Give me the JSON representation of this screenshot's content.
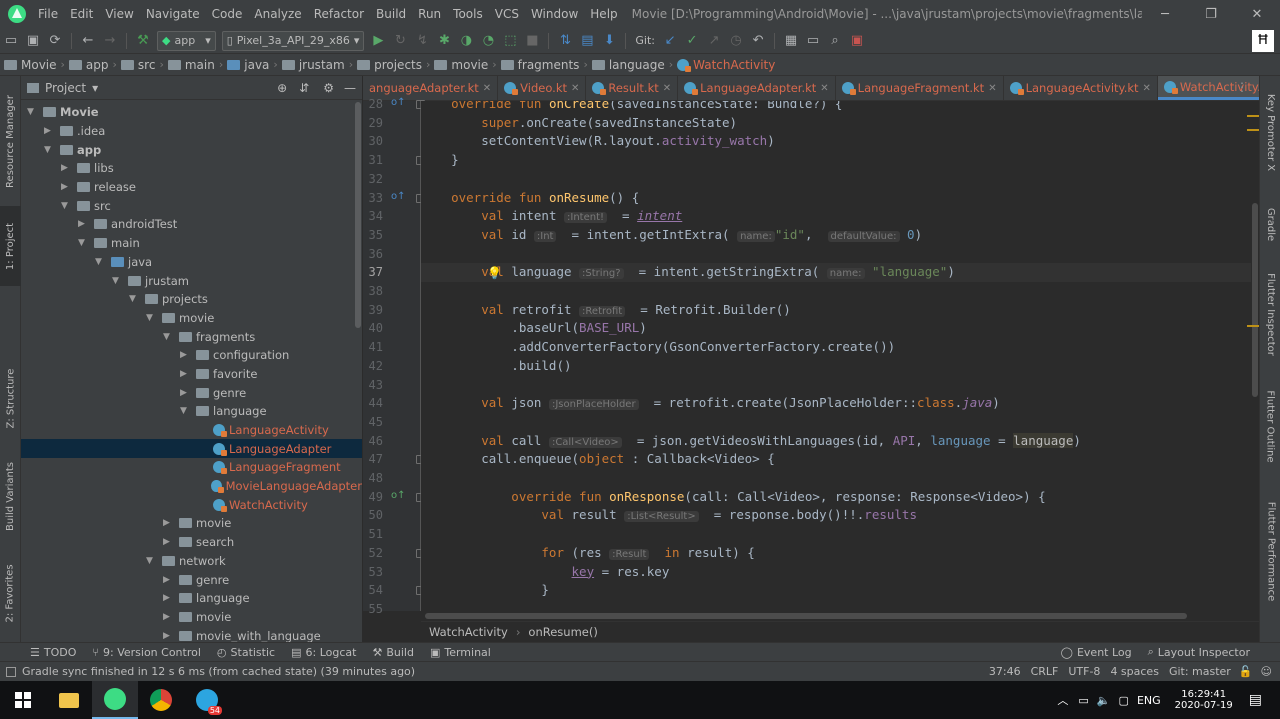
{
  "menubar": {
    "items": [
      "File",
      "Edit",
      "View",
      "Navigate",
      "Code",
      "Analyze",
      "Refactor",
      "Build",
      "Run",
      "Tools",
      "VCS",
      "Window",
      "Help"
    ],
    "title": "Movie [D:\\Programming\\Android\\Movie] - ...\\java\\jrustam\\projects\\movie\\fragments\\language\\WatchActivity.kt [app]",
    "minimize": "─",
    "maximize": "❐",
    "close": "✕"
  },
  "toolbar": {
    "module": "app",
    "device": "Pixel_3a_API_29_x86",
    "git_label": "Git:"
  },
  "navbar": {
    "crumbs": [
      "Movie",
      "app",
      "src",
      "main",
      "java",
      "jrustam",
      "projects",
      "movie",
      "fragments",
      "language",
      "WatchActivity"
    ]
  },
  "project_panel": {
    "title": "Project",
    "tree": [
      {
        "label": "Movie",
        "arrow": "▼",
        "kind": "folder",
        "bold": true
      },
      {
        "label": ".idea",
        "arrow": "▶",
        "kind": "folder"
      },
      {
        "label": "app",
        "arrow": "▼",
        "kind": "folder",
        "bold": true
      },
      {
        "label": "libs",
        "arrow": "▶",
        "kind": "folder"
      },
      {
        "label": "release",
        "arrow": "▶",
        "kind": "folder"
      },
      {
        "label": "src",
        "arrow": "▼",
        "kind": "folder"
      },
      {
        "label": "androidTest",
        "arrow": "▶",
        "kind": "folder"
      },
      {
        "label": "main",
        "arrow": "▼",
        "kind": "folder"
      },
      {
        "label": "java",
        "arrow": "▼",
        "kind": "folder-blue"
      },
      {
        "label": "jrustam",
        "arrow": "▼",
        "kind": "folder"
      },
      {
        "label": "projects",
        "arrow": "▼",
        "kind": "folder"
      },
      {
        "label": "movie",
        "arrow": "▼",
        "kind": "folder"
      },
      {
        "label": "fragments",
        "arrow": "▼",
        "kind": "folder"
      },
      {
        "label": "configuration",
        "arrow": "▶",
        "kind": "folder"
      },
      {
        "label": "favorite",
        "arrow": "▶",
        "kind": "folder"
      },
      {
        "label": "genre",
        "arrow": "▶",
        "kind": "folder"
      },
      {
        "label": "language",
        "arrow": "▼",
        "kind": "folder"
      },
      {
        "label": "LanguageActivity",
        "arrow": "",
        "kind": "kt"
      },
      {
        "label": "LanguageAdapter",
        "arrow": "",
        "kind": "kt",
        "selected": true
      },
      {
        "label": "LanguageFragment",
        "arrow": "",
        "kind": "kt"
      },
      {
        "label": "MovieLanguageAdapter",
        "arrow": "",
        "kind": "kt"
      },
      {
        "label": "WatchActivity",
        "arrow": "",
        "kind": "kt"
      },
      {
        "label": "movie",
        "arrow": "▶",
        "kind": "folder"
      },
      {
        "label": "search",
        "arrow": "▶",
        "kind": "folder"
      },
      {
        "label": "network",
        "arrow": "▼",
        "kind": "folder"
      },
      {
        "label": "genre",
        "arrow": "▶",
        "kind": "folder"
      },
      {
        "label": "language",
        "arrow": "▶",
        "kind": "folder"
      },
      {
        "label": "movie",
        "arrow": "▶",
        "kind": "folder"
      },
      {
        "label": "movie_with_language",
        "arrow": "▶",
        "kind": "folder"
      }
    ]
  },
  "left_tabs": [
    "Resource Manager",
    "1: Project",
    "Z: Structure",
    "Build Variants",
    "2: Favorites"
  ],
  "right_tabs": [
    "Key Promoter X",
    "Gradle",
    "Flutter Inspector",
    "Flutter Outline",
    "Flutter Performance"
  ],
  "editor_tabs": [
    {
      "label": "anguageAdapter.kt",
      "active": false
    },
    {
      "label": "Video.kt",
      "active": false
    },
    {
      "label": "Result.kt",
      "active": false
    },
    {
      "label": "LanguageAdapter.kt",
      "active": false
    },
    {
      "label": "LanguageFragment.kt",
      "active": false
    },
    {
      "label": "LanguageActivity.kt",
      "active": false
    },
    {
      "label": "WatchActivity.kt",
      "active": true
    }
  ],
  "code": {
    "line_numbers": [
      "28",
      "29",
      "30",
      "31",
      "32",
      "33",
      "34",
      "35",
      "36",
      "37",
      "38",
      "39",
      "40",
      "41",
      "42",
      "43",
      "44",
      "45",
      "46",
      "47",
      "48",
      "49",
      "50",
      "51",
      "52",
      "53",
      "54",
      "55"
    ],
    "current_line": "37",
    "lines": [
      [
        [
          "k",
          "    override fun "
        ],
        [
          "f",
          "onCreate"
        ],
        [
          "t",
          "(savedInstanceState: Bundle?) {"
        ]
      ],
      [
        [
          "k",
          "        super"
        ],
        [
          "t",
          ".onCreate(savedInstanceState)"
        ]
      ],
      [
        [
          "t",
          "        setContentView(R.layout."
        ],
        [
          "p",
          "activity_watch"
        ],
        [
          "t",
          ")"
        ]
      ],
      [
        [
          "t",
          "    }"
        ]
      ],
      [],
      [
        [
          "k",
          "    override fun "
        ],
        [
          "f",
          "onResume"
        ],
        [
          "t",
          "() {"
        ]
      ],
      [
        [
          "k",
          "        val "
        ],
        [
          "t",
          "intent "
        ],
        [
          "h",
          ":Intent!"
        ],
        [
          "t",
          "  = "
        ],
        [
          "pi",
          "intent"
        ]
      ],
      [
        [
          "k",
          "        val "
        ],
        [
          "t",
          "id "
        ],
        [
          "h",
          ":Int"
        ],
        [
          "t",
          "  = intent.getIntExtra( "
        ],
        [
          "h",
          "name:"
        ],
        [
          "s",
          "\"id\""
        ],
        [
          "t",
          ",  "
        ],
        [
          "h",
          "defaultValue:"
        ],
        [
          "n",
          " 0"
        ],
        [
          "t",
          ")"
        ]
      ],
      [],
      [
        [
          "k",
          "        val "
        ],
        [
          "t",
          "language "
        ],
        [
          "h",
          ":String?"
        ],
        [
          "t",
          "  = intent.getStringExtra( "
        ],
        [
          "h",
          "name:"
        ],
        [
          "s",
          " \"language\""
        ],
        [
          "t",
          ")"
        ]
      ],
      [],
      [
        [
          "k",
          "        val "
        ],
        [
          "t",
          "retrofit "
        ],
        [
          "h",
          ":Retrofit"
        ],
        [
          "t",
          "  = Retrofit.Builder()"
        ]
      ],
      [
        [
          "t",
          "            .baseUrl("
        ],
        [
          "p",
          "BASE_URL"
        ],
        [
          "t",
          ")"
        ]
      ],
      [
        [
          "t",
          "            .addConverterFactory(GsonConverterFactory.create())"
        ]
      ],
      [
        [
          "t",
          "            .build()"
        ]
      ],
      [],
      [
        [
          "k",
          "        val "
        ],
        [
          "t",
          "json "
        ],
        [
          "h",
          ":JsonPlaceHolder"
        ],
        [
          "t",
          "  = retrofit.create(JsonPlaceHolder::"
        ],
        [
          "k",
          "class"
        ],
        [
          "t",
          "."
        ],
        [
          "pi2",
          "java"
        ],
        [
          "t",
          ")"
        ]
      ],
      [],
      [
        [
          "k",
          "        val "
        ],
        [
          "t",
          "call "
        ],
        [
          "h",
          ":Call<Video>"
        ],
        [
          "t",
          "  = json.getVideosWithLanguages(id, "
        ],
        [
          "p",
          "API"
        ],
        [
          "t",
          ", "
        ],
        [
          "p2",
          "language"
        ],
        [
          "t",
          " = "
        ],
        [
          "hl",
          "language"
        ],
        [
          "t",
          ")"
        ]
      ],
      [
        [
          "t",
          "        call.enqueue("
        ],
        [
          "k",
          "object "
        ],
        [
          "t",
          ": Callback<Video> {"
        ]
      ],
      [],
      [
        [
          "k",
          "            override fun "
        ],
        [
          "f",
          "onResponse"
        ],
        [
          "t",
          "(call: Call<Video>, response: Response<Video>) {"
        ]
      ],
      [
        [
          "k",
          "                val "
        ],
        [
          "t",
          "result "
        ],
        [
          "h",
          ":List<Result>"
        ],
        [
          "t",
          "  = response.body()!!."
        ],
        [
          "p",
          "results"
        ]
      ],
      [],
      [
        [
          "k",
          "                for "
        ],
        [
          "t",
          "(res "
        ],
        [
          "h",
          ":Result"
        ],
        [
          "k",
          "  in "
        ],
        [
          "t",
          "result) {"
        ]
      ],
      [
        [
          "t",
          "                    "
        ],
        [
          "pu",
          "key"
        ],
        [
          "t",
          " = res.key"
        ]
      ],
      [
        [
          "t",
          "                }"
        ]
      ],
      []
    ]
  },
  "code_breadcrumb": [
    "WatchActivity",
    "onResume()"
  ],
  "tool_windows_left": [
    "TODO",
    "9: Version Control",
    "Statistic",
    "6: Logcat",
    "Build",
    "Terminal"
  ],
  "tool_windows_right": [
    "Event Log",
    "Layout Inspector"
  ],
  "status": {
    "message": "Gradle sync finished in 12 s 6 ms (from cached state) (39 minutes ago)",
    "position": "37:46",
    "line_sep": "CRLF",
    "encoding": "UTF-8",
    "indent": "4 spaces",
    "vcs": "Git: master"
  },
  "taskbar": {
    "lang": "ENG",
    "time": "16:29:41",
    "date": "2020-07-19",
    "badge": "54"
  }
}
